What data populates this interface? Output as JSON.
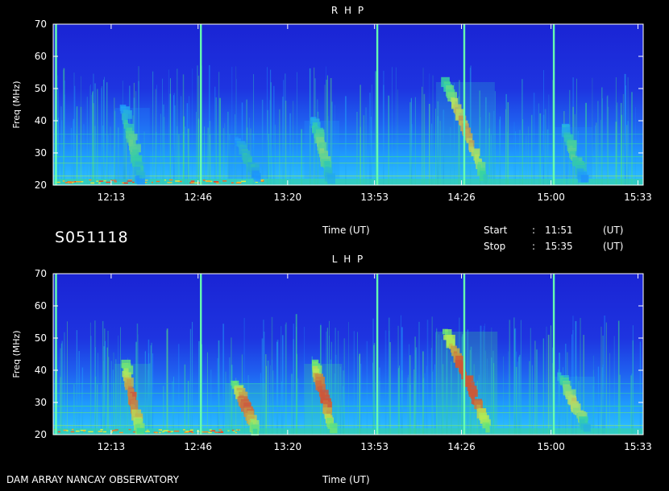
{
  "header": {
    "station_id": "S051118",
    "time_label": "Time (UT)",
    "start_label": "Start",
    "stop_label": "Stop",
    "colon": ":",
    "start_value": "11:51",
    "stop_value": "15:35",
    "ut_label": "(UT)"
  },
  "footer": {
    "observatory": "DAM ARRAY  NANCAY OBSERVATORY",
    "time_label": "Time (UT)"
  },
  "colors": {
    "background": "#000000",
    "spectrogram_base": "#1b2bd8",
    "mid": "#1ea0ff",
    "high": "#3ce08c",
    "peak": "#ff2a1a",
    "marker": "#66ffb0"
  },
  "chart_data": [
    {
      "type": "heatmap",
      "title": "R H P",
      "xlabel": "",
      "ylabel": "Freq (MHz)",
      "ylim": [
        20,
        70
      ],
      "xlim": [
        "11:51",
        "15:35"
      ],
      "xticks": [
        "12:13",
        "12:46",
        "13:20",
        "13:53",
        "14:26",
        "15:00",
        "15:33"
      ],
      "yticks": [
        20,
        30,
        40,
        50,
        60,
        70
      ],
      "vertical_markers": [
        "11:52",
        "12:47",
        "13:54",
        "14:27",
        "15:01"
      ],
      "bursts": [
        {
          "start": "12:18",
          "end": "12:24",
          "f_high": 44,
          "f_low": 21,
          "intensity": 0.55
        },
        {
          "start": "13:01",
          "end": "13:09",
          "f_high": 34,
          "f_low": 22,
          "intensity": 0.45
        },
        {
          "start": "13:30",
          "end": "13:36",
          "f_high": 40,
          "f_low": 22,
          "intensity": 0.6
        },
        {
          "start": "14:20",
          "end": "14:35",
          "f_high": 52,
          "f_low": 22,
          "intensity": 0.8
        },
        {
          "start": "15:05",
          "end": "15:12",
          "f_high": 38,
          "f_low": 22,
          "intensity": 0.55
        }
      ]
    },
    {
      "type": "heatmap",
      "title": "L H P",
      "xlabel": "Time (UT)",
      "ylabel": "Freq (MHz)",
      "ylim": [
        20,
        70
      ],
      "xlim": [
        "11:51",
        "15:35"
      ],
      "xticks": [
        "12:13",
        "12:46",
        "13:20",
        "13:53",
        "14:26",
        "15:00",
        "15:33"
      ],
      "yticks": [
        20,
        30,
        40,
        50,
        60,
        70
      ],
      "vertical_markers": [
        "11:52",
        "12:47",
        "13:54",
        "14:27",
        "15:01"
      ],
      "bursts": [
        {
          "start": "12:18",
          "end": "12:24",
          "f_high": 42,
          "f_low": 21,
          "intensity": 0.9
        },
        {
          "start": "13:00",
          "end": "13:08",
          "f_high": 36,
          "f_low": 21,
          "intensity": 0.9
        },
        {
          "start": "13:30",
          "end": "13:37",
          "f_high": 42,
          "f_low": 22,
          "intensity": 0.95
        },
        {
          "start": "14:20",
          "end": "14:36",
          "f_high": 52,
          "f_low": 22,
          "intensity": 1.0
        },
        {
          "start": "15:04",
          "end": "15:13",
          "f_high": 38,
          "f_low": 22,
          "intensity": 0.7
        }
      ]
    }
  ]
}
